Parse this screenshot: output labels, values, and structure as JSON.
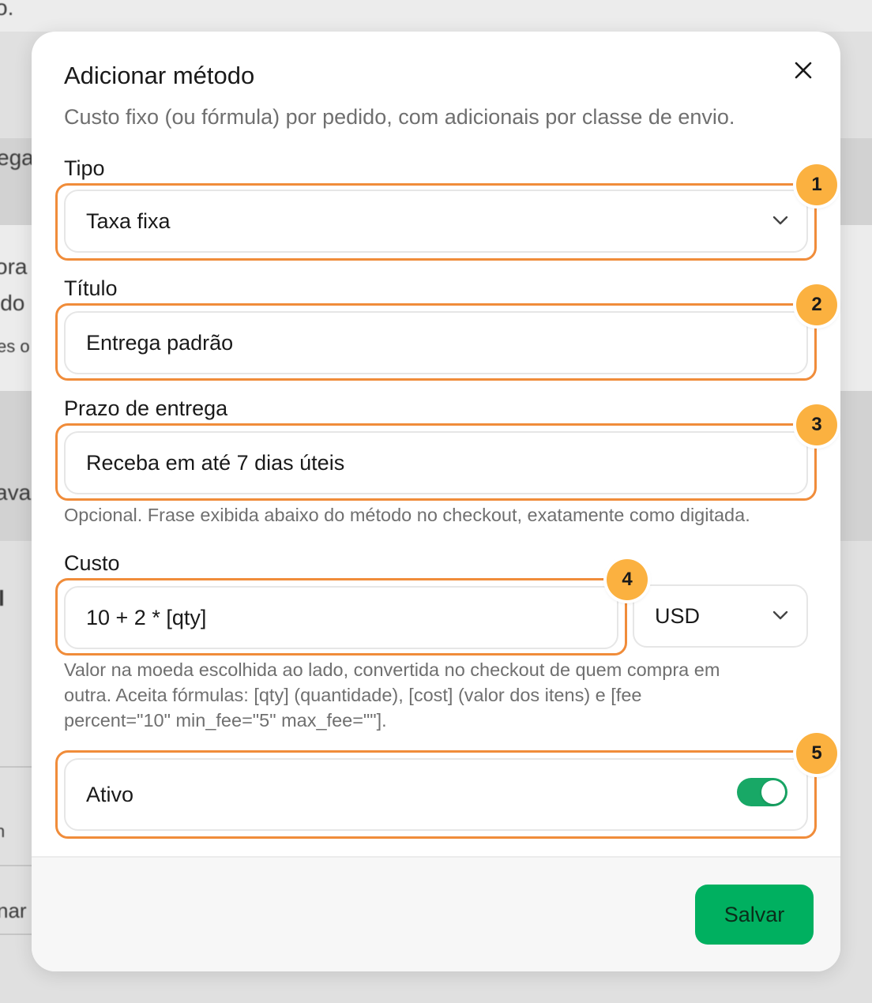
{
  "background": {
    "fragments": [
      "o.",
      "ega",
      "ora",
      "ido",
      "es o",
      "aval",
      "l",
      "n",
      "nar"
    ]
  },
  "modal": {
    "title": "Adicionar método",
    "description": "Custo fixo (ou fórmula) por pedido, com adicionais por classe de envio.",
    "close_icon": "close-icon"
  },
  "form": {
    "tipo": {
      "label": "Tipo",
      "value": "Taxa fixa"
    },
    "titulo": {
      "label": "Título",
      "value": "Entrega padrão"
    },
    "prazo": {
      "label": "Prazo de entrega",
      "value": "Receba em até 7 dias úteis",
      "help": "Opcional. Frase exibida abaixo do método no checkout, exatamente como digitada."
    },
    "custo": {
      "label": "Custo",
      "value": "10 + 2 * [qty]",
      "currency": "USD",
      "help_line1": "Valor na moeda escolhida ao lado, convertida no checkout de quem compra em",
      "help_line2": "outra. Aceita fórmulas: [qty] (quantidade), [cost] (valor dos itens) e [fee",
      "help_line3": "percent=\"10\" min_fee=\"5\" max_fee=\"\"]."
    },
    "ativo": {
      "label": "Ativo",
      "enabled": true
    }
  },
  "badges": [
    "1",
    "2",
    "3",
    "4",
    "5"
  ],
  "footer": {
    "save_label": "Salvar"
  },
  "colors": {
    "highlight": "#f08c3a",
    "badge": "#fbb140",
    "primary": "#00b060",
    "toggle_on": "#18a866"
  }
}
